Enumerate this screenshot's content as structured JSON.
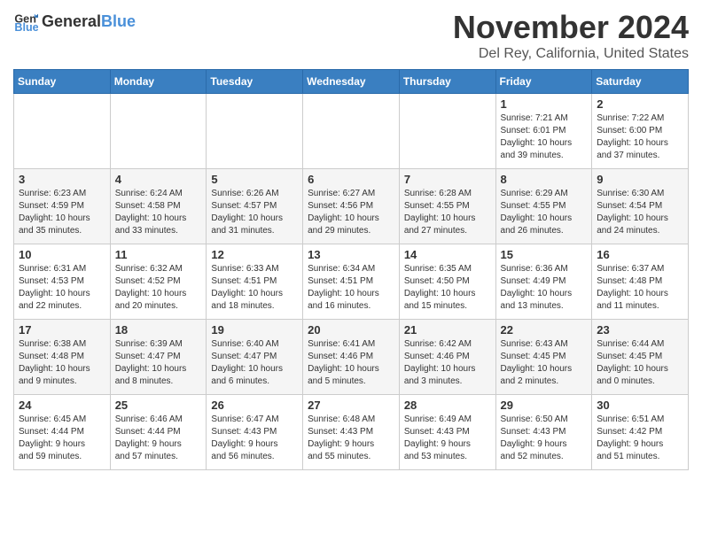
{
  "logo": {
    "text_general": "General",
    "text_blue": "Blue"
  },
  "header": {
    "month": "November 2024",
    "location": "Del Rey, California, United States"
  },
  "weekdays": [
    "Sunday",
    "Monday",
    "Tuesday",
    "Wednesday",
    "Thursday",
    "Friday",
    "Saturday"
  ],
  "weeks": [
    {
      "days": [
        {
          "num": "",
          "info": ""
        },
        {
          "num": "",
          "info": ""
        },
        {
          "num": "",
          "info": ""
        },
        {
          "num": "",
          "info": ""
        },
        {
          "num": "",
          "info": ""
        },
        {
          "num": "1",
          "info": "Sunrise: 7:21 AM\nSunset: 6:01 PM\nDaylight: 10 hours\nand 39 minutes."
        },
        {
          "num": "2",
          "info": "Sunrise: 7:22 AM\nSunset: 6:00 PM\nDaylight: 10 hours\nand 37 minutes."
        }
      ]
    },
    {
      "days": [
        {
          "num": "3",
          "info": "Sunrise: 6:23 AM\nSunset: 4:59 PM\nDaylight: 10 hours\nand 35 minutes."
        },
        {
          "num": "4",
          "info": "Sunrise: 6:24 AM\nSunset: 4:58 PM\nDaylight: 10 hours\nand 33 minutes."
        },
        {
          "num": "5",
          "info": "Sunrise: 6:26 AM\nSunset: 4:57 PM\nDaylight: 10 hours\nand 31 minutes."
        },
        {
          "num": "6",
          "info": "Sunrise: 6:27 AM\nSunset: 4:56 PM\nDaylight: 10 hours\nand 29 minutes."
        },
        {
          "num": "7",
          "info": "Sunrise: 6:28 AM\nSunset: 4:55 PM\nDaylight: 10 hours\nand 27 minutes."
        },
        {
          "num": "8",
          "info": "Sunrise: 6:29 AM\nSunset: 4:55 PM\nDaylight: 10 hours\nand 26 minutes."
        },
        {
          "num": "9",
          "info": "Sunrise: 6:30 AM\nSunset: 4:54 PM\nDaylight: 10 hours\nand 24 minutes."
        }
      ]
    },
    {
      "days": [
        {
          "num": "10",
          "info": "Sunrise: 6:31 AM\nSunset: 4:53 PM\nDaylight: 10 hours\nand 22 minutes."
        },
        {
          "num": "11",
          "info": "Sunrise: 6:32 AM\nSunset: 4:52 PM\nDaylight: 10 hours\nand 20 minutes."
        },
        {
          "num": "12",
          "info": "Sunrise: 6:33 AM\nSunset: 4:51 PM\nDaylight: 10 hours\nand 18 minutes."
        },
        {
          "num": "13",
          "info": "Sunrise: 6:34 AM\nSunset: 4:51 PM\nDaylight: 10 hours\nand 16 minutes."
        },
        {
          "num": "14",
          "info": "Sunrise: 6:35 AM\nSunset: 4:50 PM\nDaylight: 10 hours\nand 15 minutes."
        },
        {
          "num": "15",
          "info": "Sunrise: 6:36 AM\nSunset: 4:49 PM\nDaylight: 10 hours\nand 13 minutes."
        },
        {
          "num": "16",
          "info": "Sunrise: 6:37 AM\nSunset: 4:48 PM\nDaylight: 10 hours\nand 11 minutes."
        }
      ]
    },
    {
      "days": [
        {
          "num": "17",
          "info": "Sunrise: 6:38 AM\nSunset: 4:48 PM\nDaylight: 10 hours\nand 9 minutes."
        },
        {
          "num": "18",
          "info": "Sunrise: 6:39 AM\nSunset: 4:47 PM\nDaylight: 10 hours\nand 8 minutes."
        },
        {
          "num": "19",
          "info": "Sunrise: 6:40 AM\nSunset: 4:47 PM\nDaylight: 10 hours\nand 6 minutes."
        },
        {
          "num": "20",
          "info": "Sunrise: 6:41 AM\nSunset: 4:46 PM\nDaylight: 10 hours\nand 5 minutes."
        },
        {
          "num": "21",
          "info": "Sunrise: 6:42 AM\nSunset: 4:46 PM\nDaylight: 10 hours\nand 3 minutes."
        },
        {
          "num": "22",
          "info": "Sunrise: 6:43 AM\nSunset: 4:45 PM\nDaylight: 10 hours\nand 2 minutes."
        },
        {
          "num": "23",
          "info": "Sunrise: 6:44 AM\nSunset: 4:45 PM\nDaylight: 10 hours\nand 0 minutes."
        }
      ]
    },
    {
      "days": [
        {
          "num": "24",
          "info": "Sunrise: 6:45 AM\nSunset: 4:44 PM\nDaylight: 9 hours\nand 59 minutes."
        },
        {
          "num": "25",
          "info": "Sunrise: 6:46 AM\nSunset: 4:44 PM\nDaylight: 9 hours\nand 57 minutes."
        },
        {
          "num": "26",
          "info": "Sunrise: 6:47 AM\nSunset: 4:43 PM\nDaylight: 9 hours\nand 56 minutes."
        },
        {
          "num": "27",
          "info": "Sunrise: 6:48 AM\nSunset: 4:43 PM\nDaylight: 9 hours\nand 55 minutes."
        },
        {
          "num": "28",
          "info": "Sunrise: 6:49 AM\nSunset: 4:43 PM\nDaylight: 9 hours\nand 53 minutes."
        },
        {
          "num": "29",
          "info": "Sunrise: 6:50 AM\nSunset: 4:43 PM\nDaylight: 9 hours\nand 52 minutes."
        },
        {
          "num": "30",
          "info": "Sunrise: 6:51 AM\nSunset: 4:42 PM\nDaylight: 9 hours\nand 51 minutes."
        }
      ]
    }
  ]
}
